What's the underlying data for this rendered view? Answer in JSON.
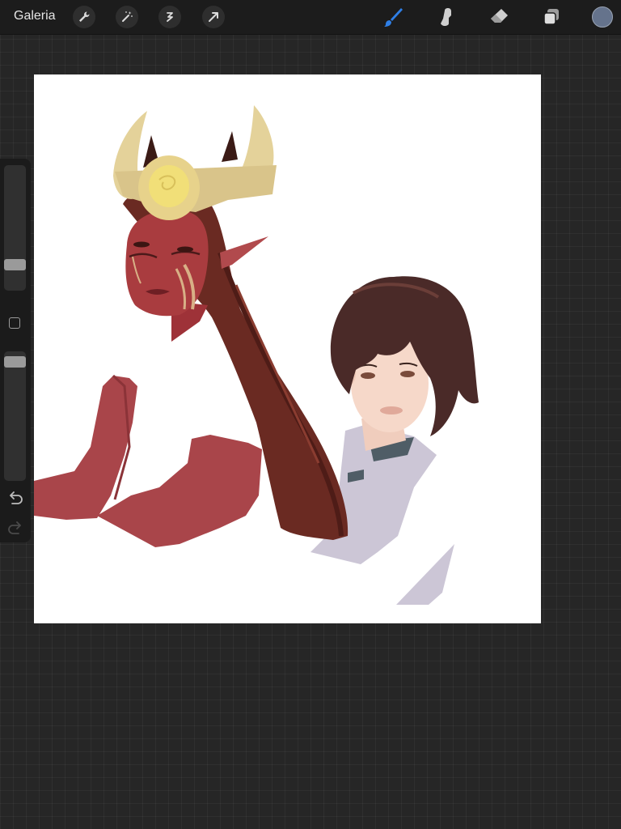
{
  "toolbar": {
    "gallery_label": "Galeria",
    "left_tools": [
      "wrench-icon",
      "magic-wand-icon",
      "selection-icon",
      "transform-arrow-icon"
    ],
    "right_tools": [
      "brush-icon",
      "smudge-icon",
      "eraser-icon",
      "layers-icon"
    ],
    "active_tool": "brush-icon",
    "active_tool_color": "#2f7fe6",
    "current_color": "#65738c"
  },
  "sidebar": {
    "brush_size_level": 0.18,
    "opacity_level": 0.96
  },
  "canvas": {
    "background": "#ffffff",
    "content": "illustration-two-characters"
  }
}
